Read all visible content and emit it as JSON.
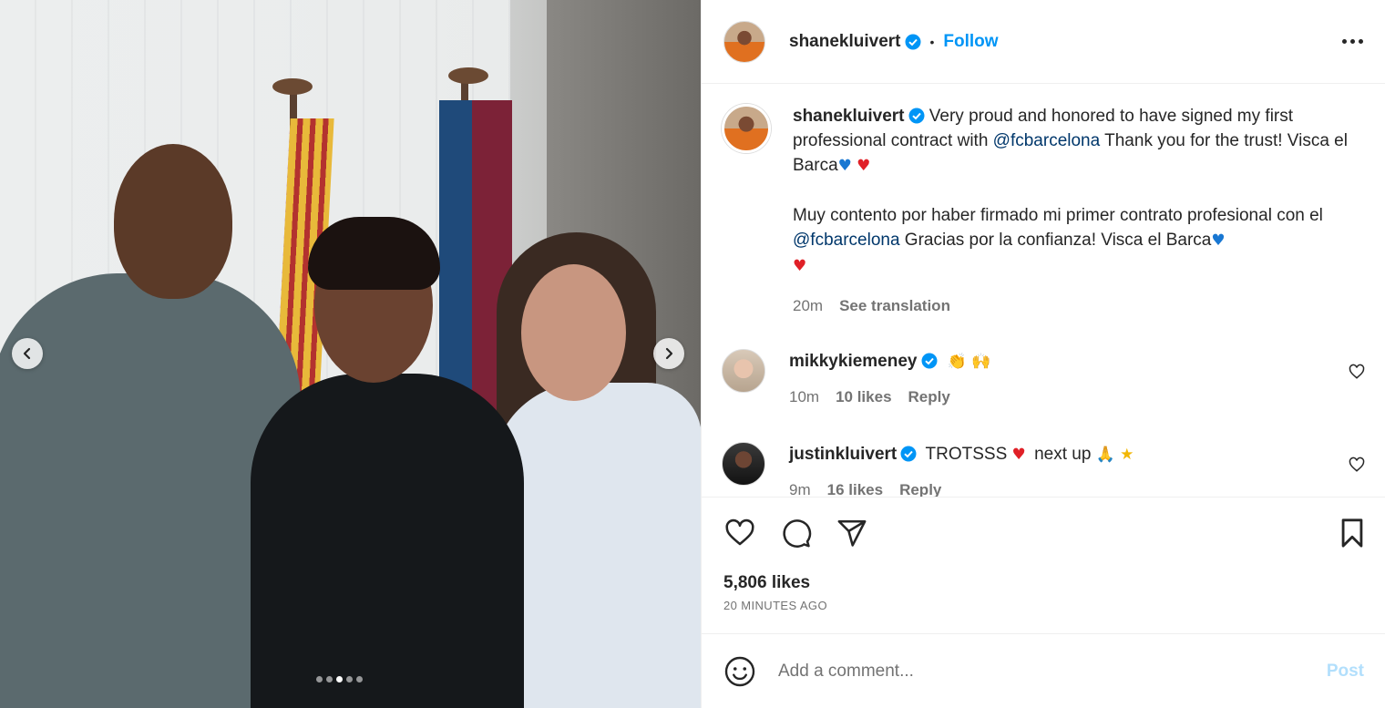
{
  "post": {
    "author": "shanekluivert",
    "follow_label": "Follow",
    "separator": "•",
    "caption": {
      "line1_pre": "Very proud and honored to have signed my first professional contract with ",
      "mention1": "@fcbarcelona",
      "line1_post": " Thank you for the trust! Visca el Barca",
      "line2_pre": "Muy contento por haber firmado mi primer contrato profesional con el ",
      "mention2": "@fcbarcelona",
      "line2_post": " Gracias por la confianza! Visca el Barca",
      "emoji_blue_heart": "♥",
      "emoji_red_heart": "♥"
    },
    "caption_time": "20m",
    "see_translation": "See translation",
    "likes": "5,806 likes",
    "posted_ago": "20 MINUTES AGO"
  },
  "comments": [
    {
      "username": "mikkykiemeney",
      "text": "",
      "emojis": "👏 🙌",
      "time": "10m",
      "likes": "10 likes",
      "reply": "Reply"
    },
    {
      "username": "justinkluivert",
      "text": "TROTSSS",
      "text2": "next up",
      "emoji_heart": "♥",
      "emoji_pray": "🙏",
      "emoji_star": "★",
      "time": "9m",
      "likes": "16 likes",
      "reply": "Reply"
    }
  ],
  "composer": {
    "placeholder": "Add a comment...",
    "post_label": "Post"
  },
  "carousel": {
    "dot_count": 5,
    "active_index": 2
  },
  "colors": {
    "accent": "#0095f6",
    "mention": "#00376b",
    "muted": "#737373",
    "post_disabled": "#b2dffc"
  },
  "icons": [
    "chevron-left-icon",
    "chevron-right-icon",
    "verified-badge-icon",
    "more-options-icon",
    "heart-icon",
    "comment-icon",
    "share-icon",
    "bookmark-icon",
    "emoji-icon"
  ]
}
